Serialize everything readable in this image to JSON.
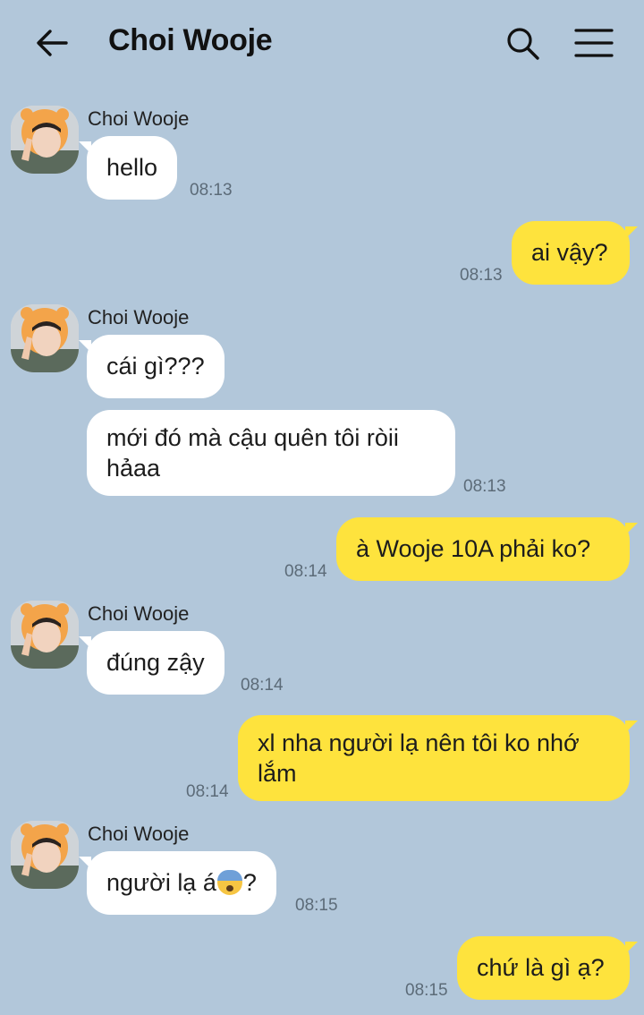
{
  "header": {
    "title": "Choi Wooje"
  },
  "messages": [
    {
      "sender": "Choi Wooje",
      "text": "hello",
      "time": "08:13"
    },
    {
      "text": "ai vậy?",
      "time": "08:13"
    },
    {
      "sender": "Choi Wooje",
      "text": "cái gì???"
    },
    {
      "text_line1": "mới đó mà cậu quên tôi ròii",
      "text_line2": "hảaa",
      "time": "08:13"
    },
    {
      "text": "à Wooje 10A phải ko?",
      "time": "08:14"
    },
    {
      "sender": "Choi Wooje",
      "text": "đúng zậy",
      "time": "08:14"
    },
    {
      "text_line1": "xl nha người lạ nên tôi ko nhớ",
      "text_line2": "lắm",
      "time": "08:14"
    },
    {
      "sender": "Choi Wooje",
      "text_before": "người lạ á",
      "text_after": "?",
      "time": "08:15"
    },
    {
      "text": "chứ là gì ạ?",
      "time": "08:15"
    }
  ]
}
